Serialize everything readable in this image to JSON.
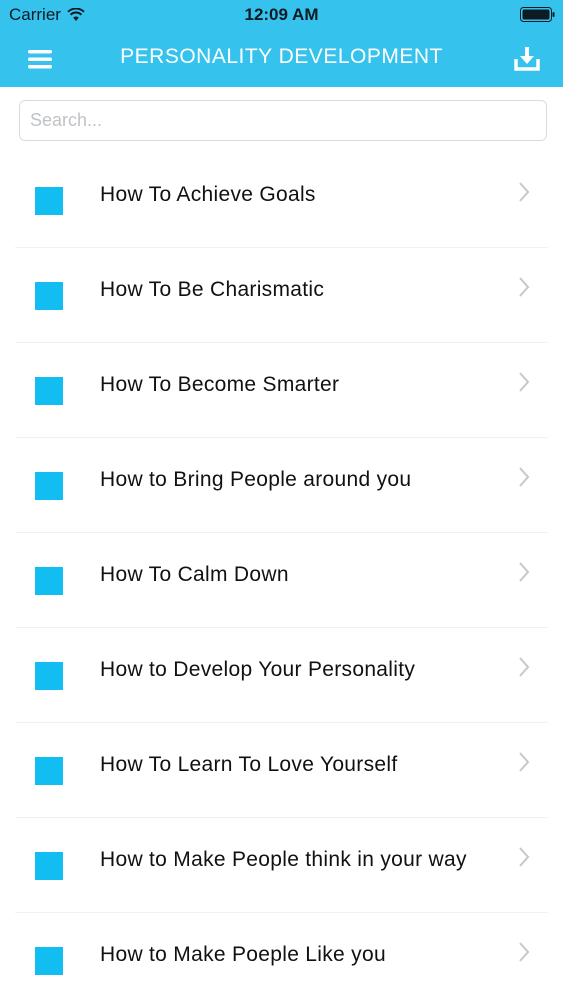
{
  "status_bar": {
    "carrier": "Carrier",
    "time": "12:09 AM"
  },
  "nav": {
    "title": "PERSONALITY DEVELOPMENT",
    "menu_icon": "hamburger-menu-icon",
    "download_icon": "download-icon"
  },
  "search": {
    "placeholder": "Search...",
    "value": ""
  },
  "list": {
    "items": [
      {
        "label": "How To Achieve Goals"
      },
      {
        "label": "How To Be Charismatic"
      },
      {
        "label": "How To Become Smarter"
      },
      {
        "label": "How to Bring People around you"
      },
      {
        "label": "How To Calm Down"
      },
      {
        "label": "How to Develop Your Personality"
      },
      {
        "label": "How To Learn To Love Yourself"
      },
      {
        "label": "How to Make People think in your way"
      },
      {
        "label": "How to Make Poeple Like you"
      }
    ]
  },
  "colors": {
    "accent": "#35c3ee",
    "item_square": "#12bdf2"
  }
}
